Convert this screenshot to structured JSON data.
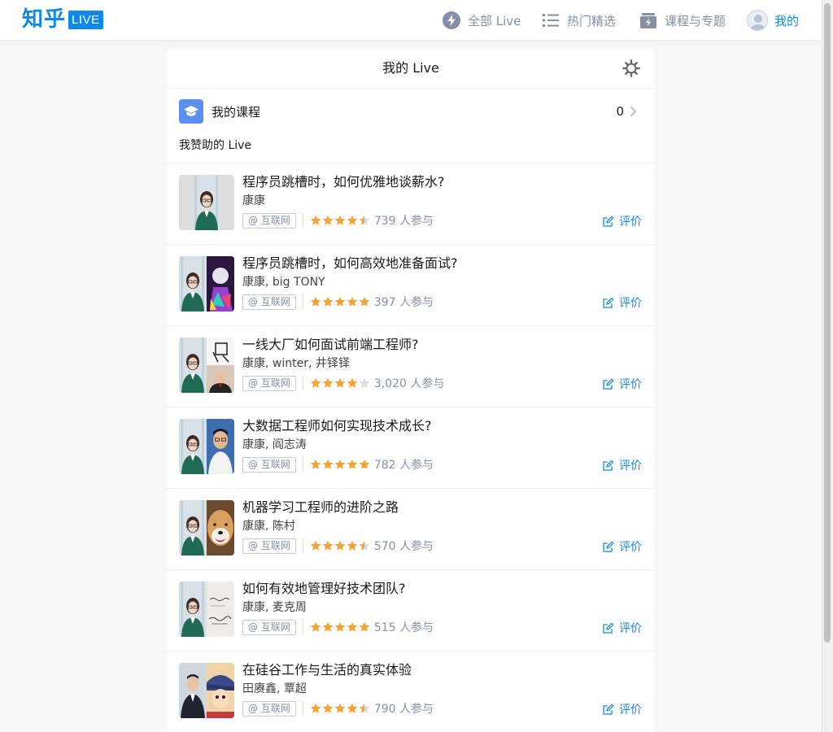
{
  "header": {
    "logo_text": "知乎",
    "logo_badge": "LIVE",
    "nav": [
      {
        "label": "全部 Live",
        "icon": "lightning-icon"
      },
      {
        "label": "热门精选",
        "icon": "list-icon"
      },
      {
        "label": "课程与专题",
        "icon": "course-box-icon"
      },
      {
        "label": "我的",
        "icon": "avatar"
      }
    ]
  },
  "card": {
    "title": "我的 Live",
    "course_label": "我的课程",
    "course_count": "0",
    "section_label": "我赞助的 Live"
  },
  "items": [
    {
      "title": "程序员跳槽时，如何优雅地谈薪水?",
      "speakers": "康康",
      "tag": "@ 互联网",
      "rating": 4.5,
      "count": "739 人参与",
      "action": "评价"
    },
    {
      "title": "程序员跳槽时，如何高效地准备面试?",
      "speakers": "康康, big TONY",
      "tag": "@ 互联网",
      "rating": 5,
      "count": "397 人参与",
      "action": "评价"
    },
    {
      "title": "一线大厂如何面试前端工程师?",
      "speakers": "康康, winter, 井铎铎",
      "tag": "@ 互联网",
      "rating": 4,
      "count": "3,020 人参与",
      "action": "评价"
    },
    {
      "title": "大数据工程师如何实现技术成长?",
      "speakers": "康康, 阎志涛",
      "tag": "@ 互联网",
      "rating": 5,
      "count": "782 人参与",
      "action": "评价"
    },
    {
      "title": "机器学习工程师的进阶之路",
      "speakers": "康康, 陈村",
      "tag": "@ 互联网",
      "rating": 4.5,
      "count": "570 人参与",
      "action": "评价"
    },
    {
      "title": "如何有效地管理好技术团队?",
      "speakers": "康康, 麦克周",
      "tag": "@ 互联网",
      "rating": 5,
      "count": "515 人参与",
      "action": "评价"
    },
    {
      "title": "在硅谷工作与生活的真实体验",
      "speakers": "田赓鑫, 覃超",
      "tag": "@ 互联网",
      "rating": 4.5,
      "count": "790 人参与",
      "action": "评价"
    }
  ],
  "colors": {
    "brand": "#0f88eb",
    "star": "#f7a334",
    "star_empty": "#dcdcdc"
  }
}
